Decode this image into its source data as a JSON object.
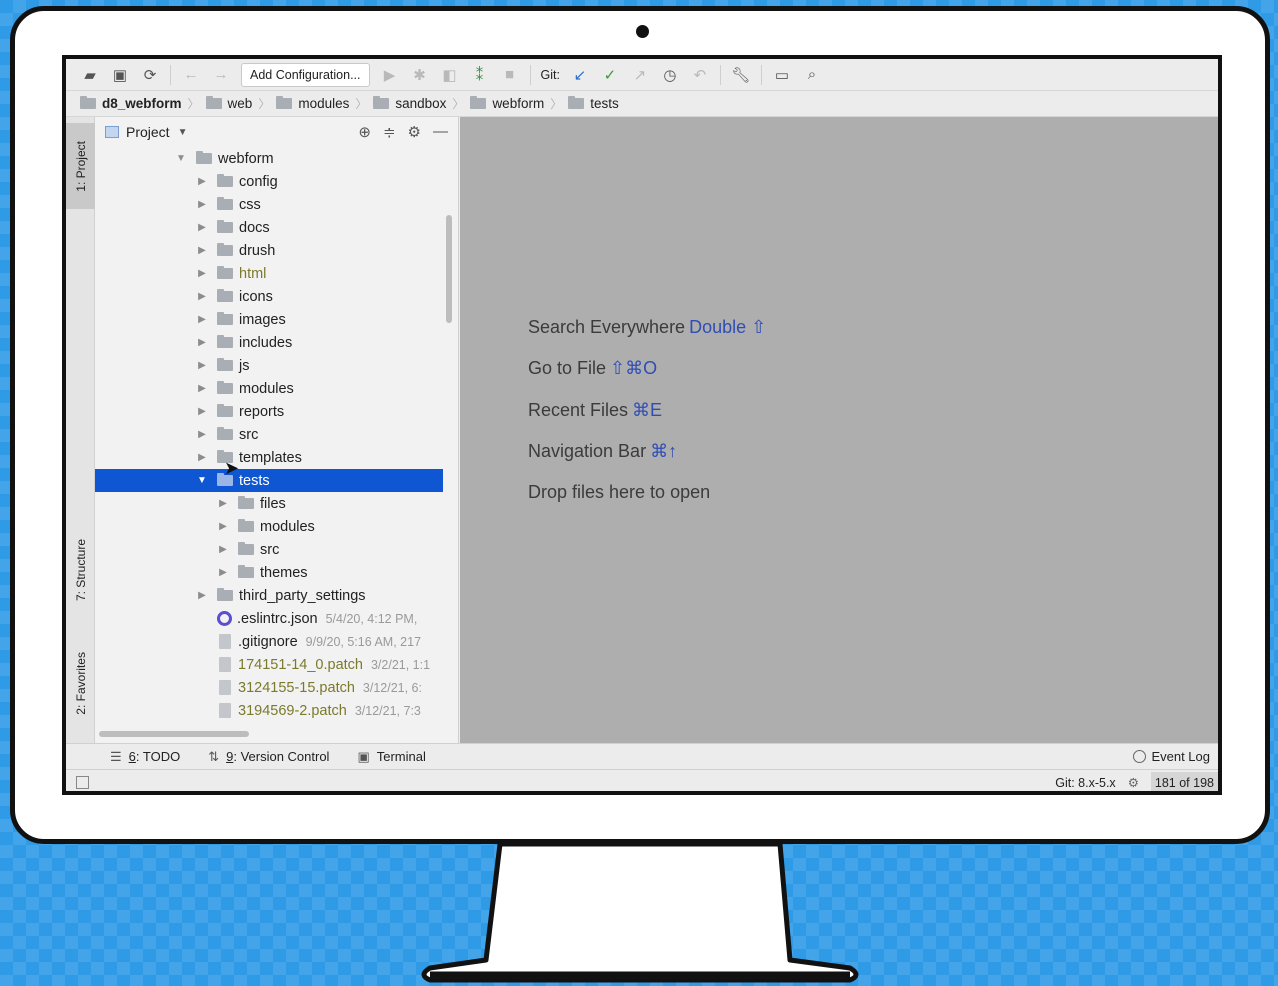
{
  "toolbar": {
    "run_config": "Add Configuration...",
    "git_label": "Git:"
  },
  "breadcrumb": [
    "d8_webform",
    "web",
    "modules",
    "sandbox",
    "webform",
    "tests"
  ],
  "left_stripe": {
    "project": "1: Project",
    "structure": "7: Structure",
    "favorites": "2: Favorites"
  },
  "project_panel": {
    "title": "Project",
    "tree": [
      {
        "name": "webform",
        "depth": 0,
        "expanded": true,
        "type": "folder"
      },
      {
        "name": "config",
        "depth": 1,
        "type": "folder"
      },
      {
        "name": "css",
        "depth": 1,
        "type": "folder"
      },
      {
        "name": "docs",
        "depth": 1,
        "type": "folder"
      },
      {
        "name": "drush",
        "depth": 1,
        "type": "folder"
      },
      {
        "name": "html",
        "depth": 1,
        "type": "folder",
        "olive": true
      },
      {
        "name": "icons",
        "depth": 1,
        "type": "folder"
      },
      {
        "name": "images",
        "depth": 1,
        "type": "folder"
      },
      {
        "name": "includes",
        "depth": 1,
        "type": "folder"
      },
      {
        "name": "js",
        "depth": 1,
        "type": "folder"
      },
      {
        "name": "modules",
        "depth": 1,
        "type": "folder"
      },
      {
        "name": "reports",
        "depth": 1,
        "type": "folder"
      },
      {
        "name": "src",
        "depth": 1,
        "type": "folder"
      },
      {
        "name": "templates",
        "depth": 1,
        "type": "folder"
      },
      {
        "name": "tests",
        "depth": 1,
        "type": "folder",
        "expanded": true,
        "selected": true
      },
      {
        "name": "files",
        "depth": 2,
        "type": "folder"
      },
      {
        "name": "modules",
        "depth": 2,
        "type": "folder"
      },
      {
        "name": "src",
        "depth": 2,
        "type": "folder"
      },
      {
        "name": "themes",
        "depth": 2,
        "type": "folder"
      },
      {
        "name": "third_party_settings",
        "depth": 1,
        "type": "folder"
      },
      {
        "name": ".eslintrc.json",
        "depth": 1,
        "type": "eslint",
        "meta": "5/4/20, 4:12 PM,"
      },
      {
        "name": ".gitignore",
        "depth": 1,
        "type": "gitignore",
        "meta": "9/9/20, 5:16 AM, 217"
      },
      {
        "name": "174151-14_0.patch",
        "depth": 1,
        "type": "patch",
        "olive": true,
        "meta": "3/2/21, 1:1"
      },
      {
        "name": "3124155-15.patch",
        "depth": 1,
        "type": "patch",
        "olive": true,
        "meta": "3/12/21, 6:"
      },
      {
        "name": "3194569-2.patch",
        "depth": 1,
        "type": "patch",
        "olive": true,
        "meta": "3/12/21, 7:3"
      }
    ]
  },
  "editor_hints": [
    {
      "text": "Search Everywhere",
      "key": "Double ⇧"
    },
    {
      "text": "Go to File",
      "key": "⇧⌘O"
    },
    {
      "text": "Recent Files",
      "key": "⌘E"
    },
    {
      "text": "Navigation Bar",
      "key": "⌘↑"
    },
    {
      "text": "Drop files here to open",
      "key": ""
    }
  ],
  "tool_windows": {
    "todo_num": "6",
    "todo_label": ": TODO",
    "vc_num": "9",
    "vc_label": ": Version Control",
    "terminal": "Terminal",
    "event_log": "Event Log"
  },
  "status_bar": {
    "git_branch": "Git: 8.x-5.x",
    "lines": "181 of 198"
  }
}
